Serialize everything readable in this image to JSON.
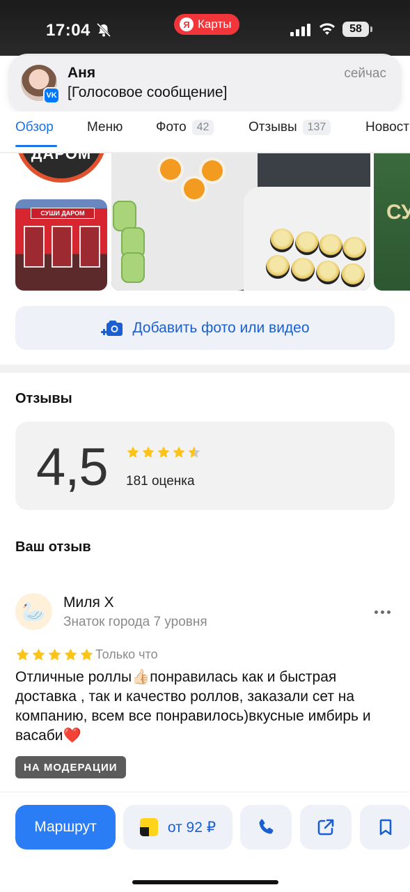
{
  "status_bar": {
    "time": "17:04",
    "mute_icon": "bell-slash-icon",
    "app_pill_label": "Карты",
    "app_pill_logo": "Я",
    "battery_level": "58"
  },
  "notification": {
    "sender": "Аня",
    "message": "[Голосовое сообщение]",
    "time": "сейчас",
    "badge": "VK"
  },
  "tabs": [
    {
      "label": "Обзор",
      "count": null
    },
    {
      "label": "Меню",
      "count": null
    },
    {
      "label": "Фото",
      "count": "42"
    },
    {
      "label": "Отзывы",
      "count": "137"
    },
    {
      "label": "Новости",
      "count": null
    }
  ],
  "photos": {
    "logo_text": "ДАРОМ",
    "storefront_sign": "СУШИ ДАРОМ",
    "right_photo_text": "СУ"
  },
  "add_photo_label": "Добавить фото или видео",
  "reviews": {
    "title": "Отзывы",
    "rating": "4,5",
    "stars": 4.5,
    "rating_count": "181 оценка",
    "your_review_title": "Ваш отзыв"
  },
  "review": {
    "avatar_emoji": "🦢",
    "author": "Миля Х",
    "level": "Знаток города 7 уровня",
    "stars": 5,
    "date": "Только что",
    "text": "Отличные роллы👍🏻понравилась как и быстрая доставка , так и качество роллов, заказали сет на компанию, всем все понравилось)вкусные имбирь и васаби❤️",
    "moderation_label": "НА МОДЕРАЦИИ"
  },
  "bottom_bar": {
    "route_label": "Маршрут",
    "taxi_label": "от 92 ₽"
  },
  "colors": {
    "accent": "#2a7df5",
    "star": "#fcc419",
    "tab_active": "#1a73e8"
  }
}
